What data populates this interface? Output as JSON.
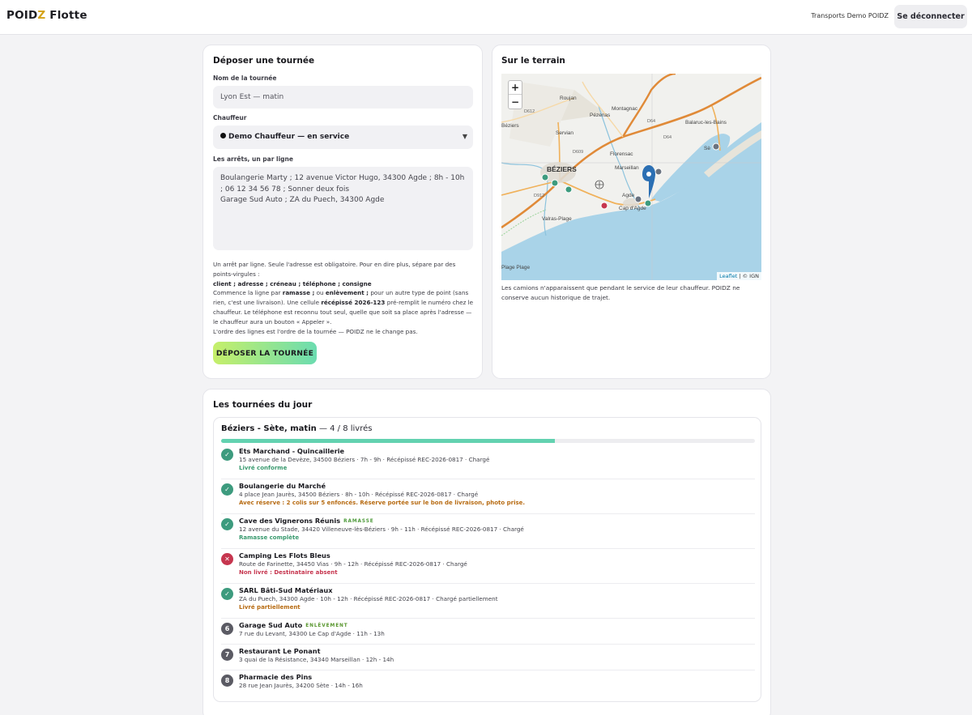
{
  "app": {
    "brand_prefix": "POID",
    "brand_z": "Z",
    "brand_suffix": " Flotte",
    "org": "Transports Demo POIDZ",
    "logout": "Se déconnecter"
  },
  "form": {
    "title": "Déposer une tournée",
    "name_label": "Nom de la tournée",
    "name_placeholder": "Lyon Est — matin",
    "driver_label": "Chauffeur",
    "driver_value": "Demo Chauffeur — en service",
    "stops_label": "Les arrêts, un par ligne",
    "stops_placeholder": "Boulangerie Marty ; 12 avenue Victor Hugo, 34300 Agde ; 8h - 10h ; 06 12 34 56 78 ; Sonner deux fois\nGarage Sud Auto ; ZA du Puech, 34300 Agde",
    "help_1": "Un arrêt par ligne. Seule l'adresse est obligatoire. Pour en dire plus, sépare par des points-virgules :",
    "help_fields": "client ; adresse ; créneau ; téléphone ; consigne",
    "help_2a": "Commence la ligne par ",
    "help_ramasse": "ramasse ;",
    "help_2b": " ou ",
    "help_enlevement": "enlèvement ;",
    "help_2c": " pour un autre type de point (sans rien, c'est une livraison). Une cellule ",
    "help_recepisse": "récépissé 2026-123",
    "help_2d": " pré-remplit le numéro chez le chauffeur. Le téléphone est reconnu tout seul, quelle que soit sa place après l'adresse — le chauffeur aura un bouton « Appeler ».",
    "help_3": "L'ordre des lignes est l'ordre de la tournée — POIDZ ne le change pas.",
    "submit": "DÉPOSER LA TOURNÉE"
  },
  "terrain": {
    "title": "Sur le terrain",
    "zoom_in": "+",
    "zoom_out": "−",
    "attribution_leaflet": "Leaflet",
    "attribution_rest": " | © IGN",
    "places": [
      "Roujan",
      "Montagnac",
      "Pézenas",
      "Béziers",
      "Servian",
      "Balaruc-les-Bains",
      "BÉZIERS",
      "Florensac",
      "Marseillan",
      "Agde",
      "Cap d'Agde",
      "Valras-Plage",
      "Sè",
      "Plage Plage",
      "D609",
      "D612",
      "D912",
      "D64",
      "D64"
    ],
    "note": "Les camions n'apparaissent que pendant le service de leur chauffeur. POIDZ ne conserve aucun historique de trajet."
  },
  "today": {
    "title": "Les tournées du jour",
    "tour_name": "Béziers - Sète, matin",
    "tour_progress": " — 4 / 8 livrés",
    "progress": 0.625,
    "stops": [
      {
        "badge": "✓",
        "status": "ok",
        "name": "Ets Marchand - Quincaillerie",
        "tag": "",
        "addr": "15 avenue de la Devèze, 34500 Béziers · 7h - 9h · Récépissé REC-2026-0817 · Chargé",
        "result": "Livré conforme",
        "result_color": "green"
      },
      {
        "badge": "✓",
        "status": "ok",
        "name": "Boulangerie du Marché",
        "tag": "",
        "addr": "4 place Jean Jaurès, 34500 Béziers · 8h - 10h · Récépissé REC-2026-0817 · Chargé",
        "result": "Avec réserve : 2 colis sur 5 enfoncés. Réserve portée sur le bon de livraison, photo prise.",
        "result_color": "orange"
      },
      {
        "badge": "✓",
        "status": "ok",
        "name": "Cave des Vignerons Réunis",
        "tag": "RAMASSE",
        "tag_kind": "ramasse",
        "addr": "12 avenue du Stade, 34420 Villeneuve-lès-Béziers · 9h - 11h · Récépissé REC-2026-0817 · Chargé",
        "result": "Ramasse complète",
        "result_color": "green"
      },
      {
        "badge": "✕",
        "status": "ko",
        "name": "Camping Les Flots Bleus",
        "tag": "",
        "addr": "Route de Farinette, 34450 Vias · 9h - 12h · Récépissé REC-2026-0817 · Chargé",
        "result": "Non livré : Destinataire absent",
        "result_color": "red"
      },
      {
        "badge": "✓",
        "status": "ok",
        "name": "SARL Bâti-Sud Matériaux",
        "tag": "",
        "addr": "ZA du Puech, 34300 Agde · 10h - 12h · Récépissé REC-2026-0817 · Chargé partiellement",
        "result": "Livré partiellement",
        "result_color": "orange"
      },
      {
        "badge": "6",
        "status": "todo",
        "name": "Garage Sud Auto",
        "tag": "ENLÈVEMENT",
        "tag_kind": "enl",
        "addr": "7 rue du Levant, 34300 Le Cap d'Agde · 11h - 13h",
        "result": "",
        "result_color": ""
      },
      {
        "badge": "7",
        "status": "todo",
        "name": "Restaurant Le Ponant",
        "tag": "",
        "addr": "3 quai de la Résistance, 34340 Marseillan · 12h - 14h",
        "result": "",
        "result_color": ""
      },
      {
        "badge": "8",
        "status": "todo",
        "name": "Pharmacie des Pins",
        "tag": "",
        "addr": "28 rue Jean Jaurès, 34200 Sète · 14h - 16h",
        "result": "",
        "result_color": ""
      }
    ]
  }
}
